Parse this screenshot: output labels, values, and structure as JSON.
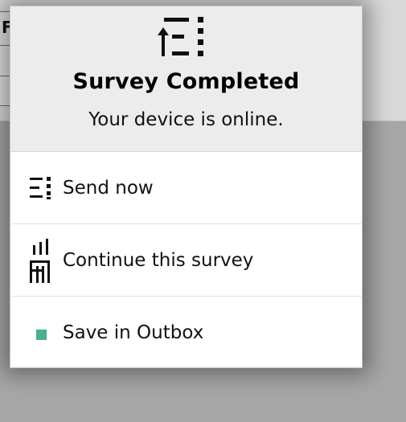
{
  "dialog": {
    "header_icon": "upload-list-icon",
    "title": "Survey Completed",
    "subtitle": "Your device is online."
  },
  "options": [
    {
      "label": "Send now",
      "icon": "send-list-icon"
    },
    {
      "label": "Continue this survey",
      "icon": "continue-survey-icon"
    },
    {
      "label": "Save in Outbox",
      "icon": "outbox-square-icon",
      "icon_color": "#4caf8a"
    }
  ],
  "background": {
    "partial_letter": "F"
  }
}
